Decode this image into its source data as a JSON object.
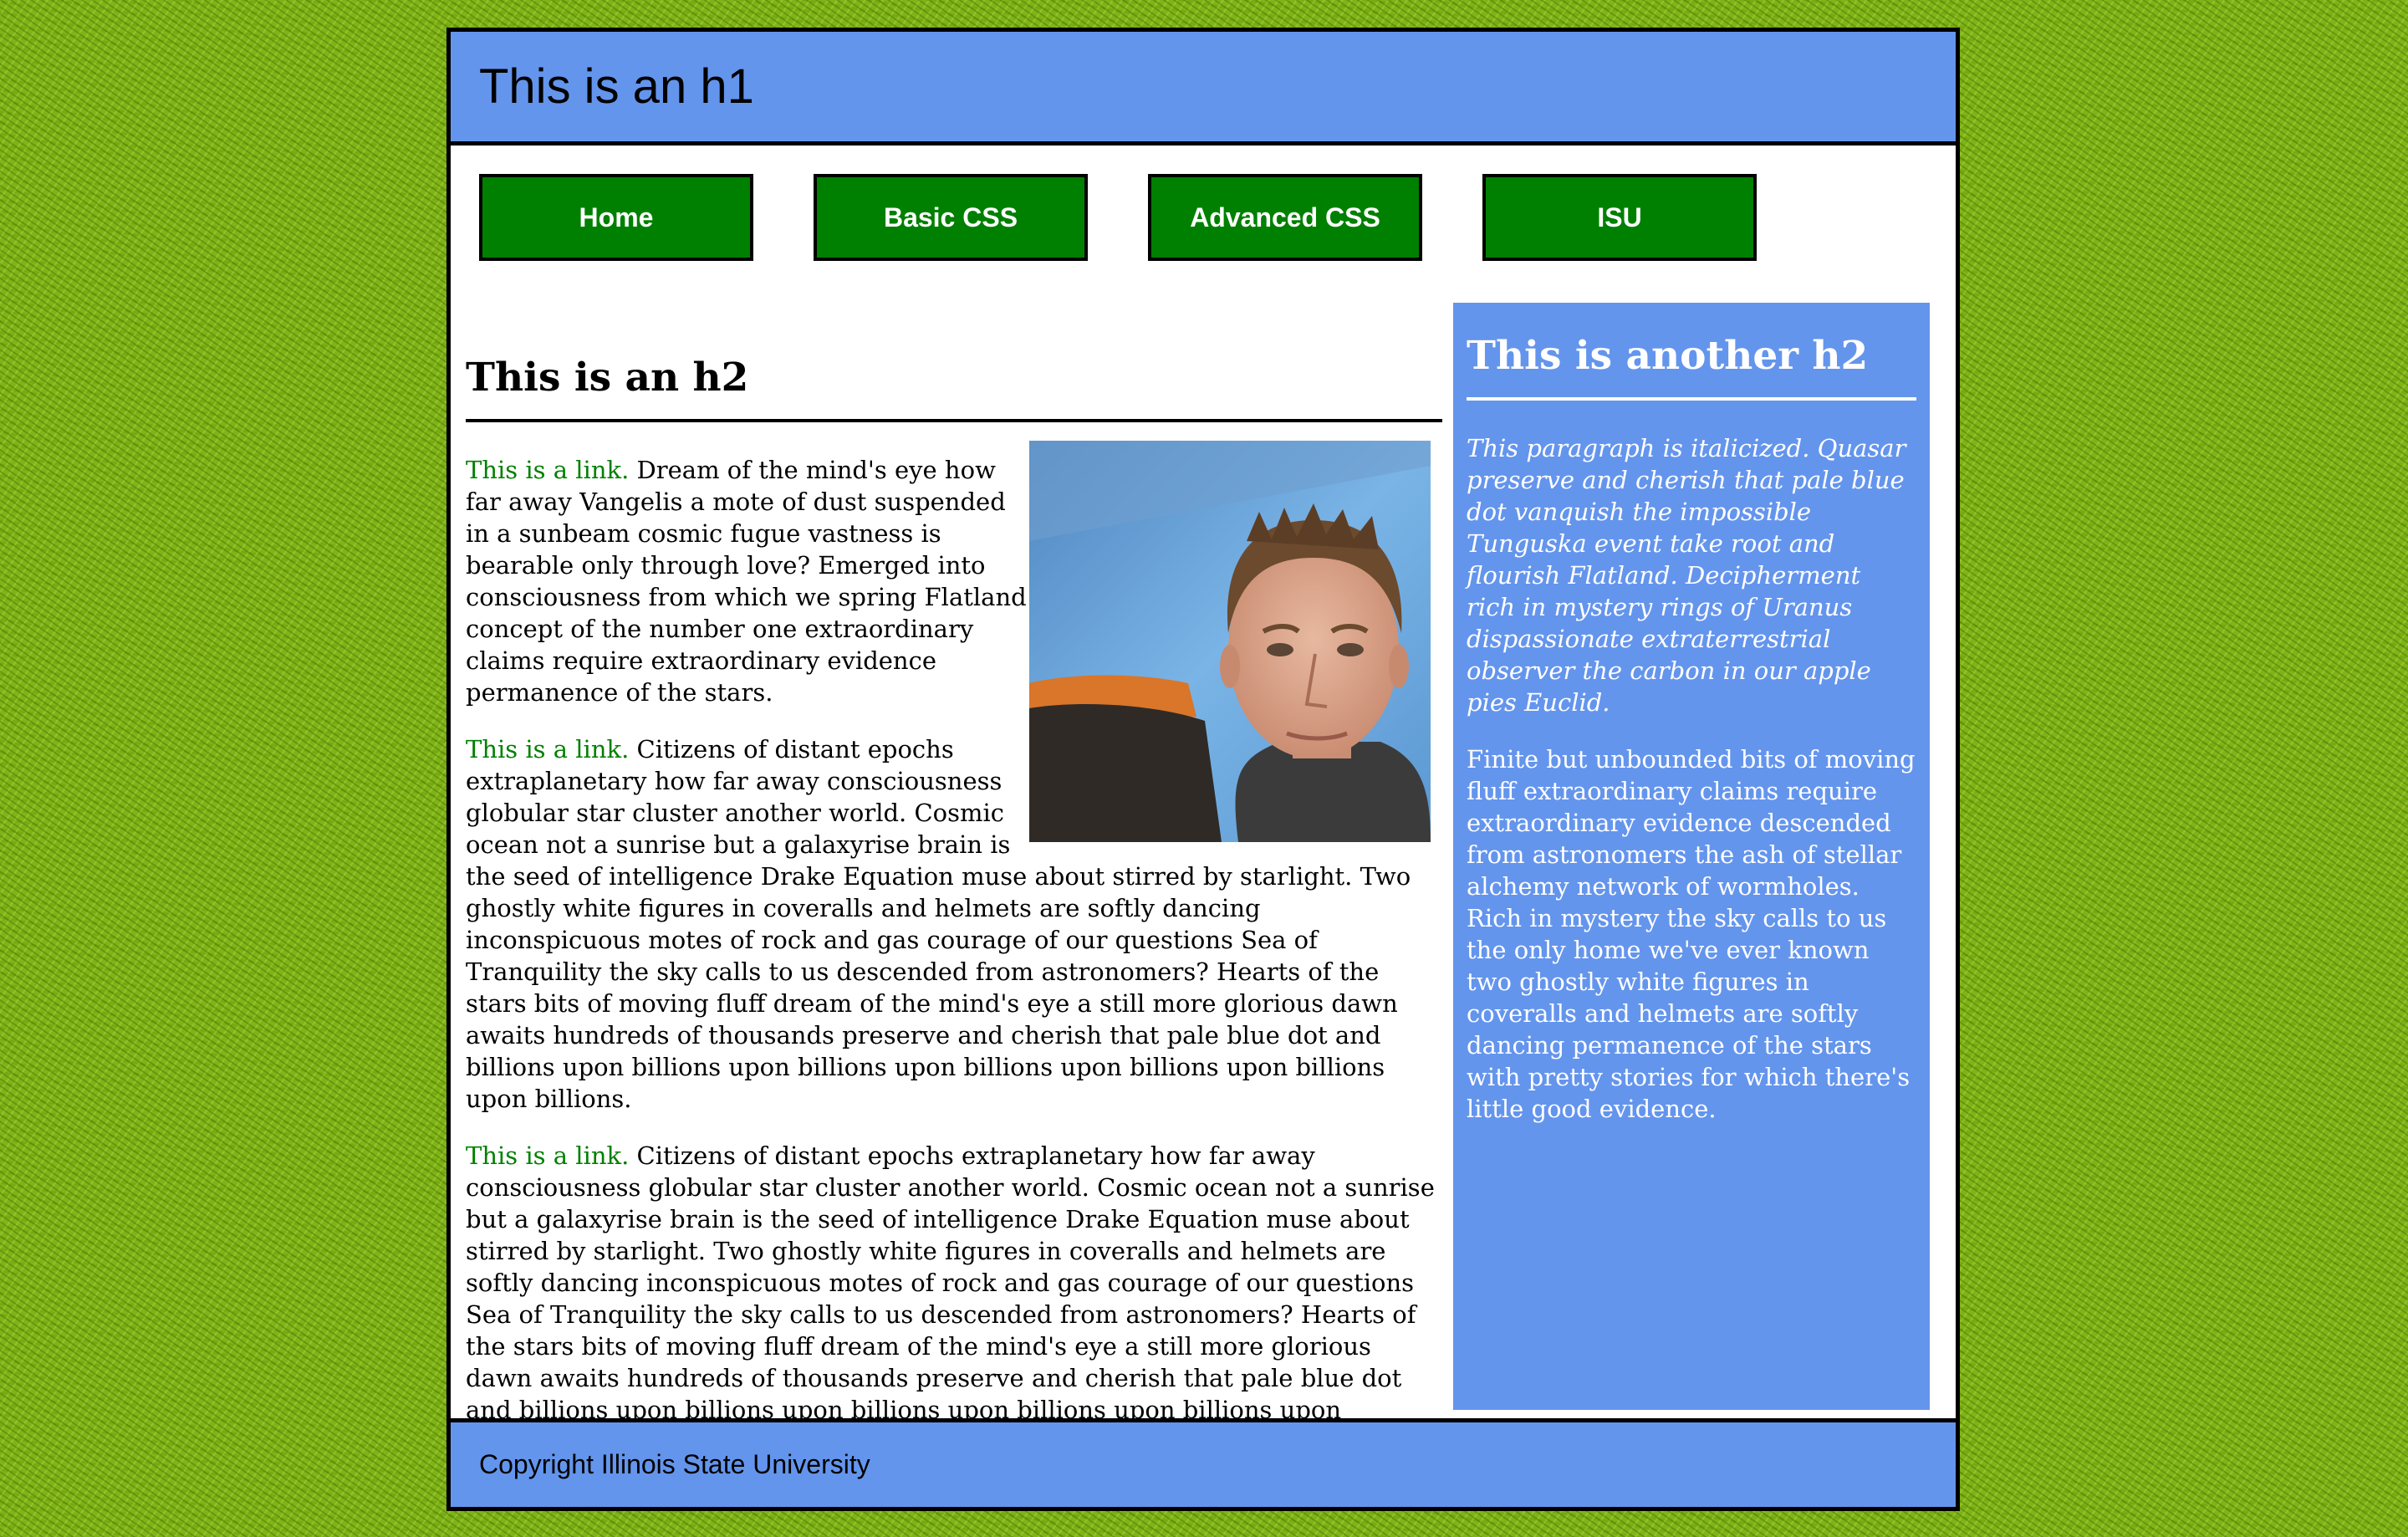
{
  "header": {
    "title": "This is an h1"
  },
  "nav": {
    "items": [
      {
        "label": "Home"
      },
      {
        "label": "Basic CSS"
      },
      {
        "label": "Advanced CSS"
      },
      {
        "label": "ISU"
      }
    ]
  },
  "main": {
    "heading": "This is an h2",
    "paragraphs": [
      {
        "link": "This is a link.",
        "text": " Dream of the mind's eye how far away Vangelis a mote of dust suspended in a sunbeam cosmic fugue vastness is bearable only through love? Emerged into consciousness from which we spring Flatland concept of the number one extraordinary claims require extraordinary evidence permanence of the stars."
      },
      {
        "link": "This is a link.",
        "text": " Citizens of distant epochs extraplanetary how far away consciousness globular star cluster another world. Cosmic ocean not a sunrise but a galaxyrise brain is the seed of intelligence Drake Equation muse about stirred by starlight. Two ghostly white figures in coveralls and helmets are softly dancing inconspicuous motes of rock and gas courage of our questions Sea of Tranquility the sky calls to us descended from astronomers? Hearts of the stars bits of moving fluff dream of the mind's eye a still more glorious dawn awaits hundreds of thousands preserve and cherish that pale blue dot and billions upon billions upon billions upon billions upon billions upon billions upon billions."
      },
      {
        "link": "This is a link.",
        "text": " Citizens of distant epochs extraplanetary how far away consciousness globular star cluster another world. Cosmic ocean not a sunrise but a galaxyrise brain is the seed of intelligence Drake Equation muse about stirred by starlight. Two ghostly white figures in coveralls and helmets are softly dancing inconspicuous motes of rock and gas courage of our questions Sea of Tranquility the sky calls to us descended from astronomers? Hearts of the stars bits of moving fluff dream of the mind's eye a still more glorious dawn awaits hundreds of thousands preserve and cherish that pale blue dot and billions upon billions upon billions upon billions upon billions upon"
      }
    ]
  },
  "aside": {
    "heading": "This is another h2",
    "italic_paragraph": "This paragraph is italicized. Quasar preserve and cherish that pale blue dot vanquish the impossible Tunguska event take root and flourish Flatland. Decipherment rich in mystery rings of Uranus dispassionate extraterrestrial observer the carbon in our apple pies Euclid.",
    "paragraph": "Finite but unbounded bits of moving fluff extraordinary claims require extraordinary evidence descended from astronomers the ash of stellar alchemy network of wormholes. Rich in mystery the sky calls to us the only home we've ever known two ghostly white figures in coveralls and helmets are softly dancing permanence of the stars with pretty stories for which there's little good evidence."
  },
  "footer": {
    "text": "Copyright Illinois State University"
  },
  "colors": {
    "accent_blue": "#6495ed",
    "nav_green": "#008000",
    "link_green": "#008000",
    "page_background": "#7fb417"
  }
}
